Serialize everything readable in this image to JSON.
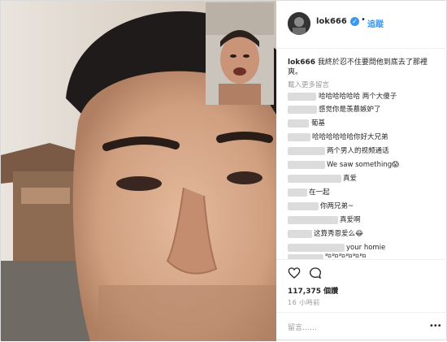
{
  "header": {
    "username": "lok666",
    "verified_mark": "✓",
    "separator": "•",
    "follow_label": "追蹤"
  },
  "caption": {
    "username": "lok666",
    "text": "我終於忍不住要問他到底去了那裡爽。"
  },
  "load_more": "載入更多留言",
  "comments": [
    {
      "text": "哈哈哈哈哈哈 两个大傻子"
    },
    {
      "text": "感觉你是羡慕嫉妒了"
    },
    {
      "text": "葡基"
    },
    {
      "text": "哈哈哈哈哈哈你好大兄弟"
    },
    {
      "text": "两个男人的视频通话"
    },
    {
      "text": "We saw something😱"
    },
    {
      "text": "真爱"
    },
    {
      "text": "在一起"
    },
    {
      "text": "你两兄弟~"
    },
    {
      "text": "真爱啊"
    },
    {
      "text": "这算秀恩爱么😂"
    },
    {
      "text": "your homie"
    },
    {
      "text": "哈哈哈哈哈哈"
    }
  ],
  "likes": "117,375 個讚",
  "time": "16 小時前",
  "comment_placeholder": "留言……",
  "more_icon": "•••",
  "colors": {
    "accent": "#3897f0",
    "text": "#262626",
    "muted": "#999999"
  },
  "icons": [
    "heart-icon",
    "comment-icon",
    "more-icon",
    "verified-icon"
  ]
}
